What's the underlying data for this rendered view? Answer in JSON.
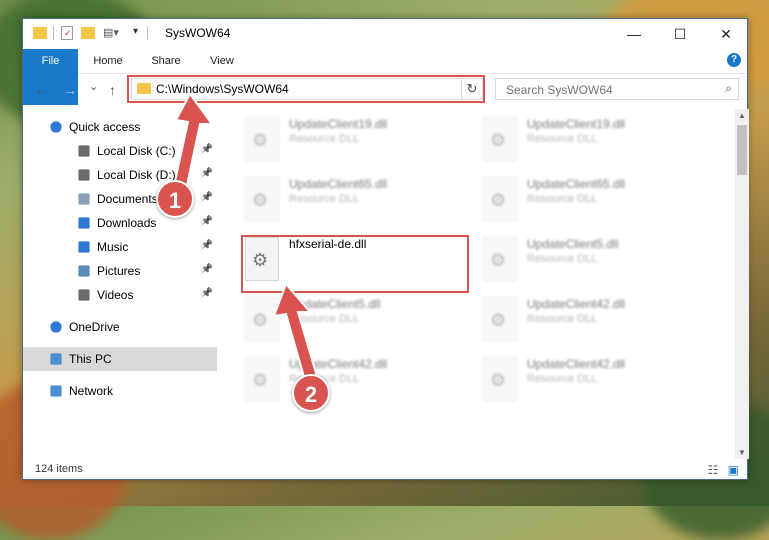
{
  "window": {
    "title": "SysWOW64",
    "controls": {
      "minimize": "—",
      "maximize": "☐",
      "close": "✕"
    }
  },
  "ribbon": {
    "tabs": [
      "File",
      "Home",
      "Share",
      "View"
    ],
    "help": "?"
  },
  "navigation": {
    "back": "←",
    "forward": "→",
    "recent": "⌄",
    "up": "↑"
  },
  "address": {
    "path": "C:\\Windows\\SysWOW64",
    "dropdown": "⌄",
    "refresh": "↻"
  },
  "search": {
    "placeholder": "Search SysWOW64",
    "icon": "⌕"
  },
  "sidebar": {
    "items": [
      {
        "label": "Quick access",
        "icon": "star-icon"
      },
      {
        "label": "Local Disk (C:)",
        "icon": "drive-icon",
        "pinned": true
      },
      {
        "label": "Local Disk (D:)",
        "icon": "drive-icon",
        "pinned": true
      },
      {
        "label": "Documents",
        "icon": "documents-icon",
        "pinned": true
      },
      {
        "label": "Downloads",
        "icon": "download-icon",
        "pinned": true
      },
      {
        "label": "Music",
        "icon": "music-icon",
        "pinned": true
      },
      {
        "label": "Pictures",
        "icon": "pictures-icon",
        "pinned": true
      },
      {
        "label": "Videos",
        "icon": "videos-icon",
        "pinned": true
      },
      {
        "label": "OneDrive",
        "icon": "cloud-icon"
      },
      {
        "label": "This PC",
        "icon": "computer-icon",
        "selected": true
      },
      {
        "label": "Network",
        "icon": "network-icon"
      }
    ],
    "pin_glyph": "📌"
  },
  "files": [
    {
      "name": "UpdateClient19.dll",
      "type": "Resource DLL",
      "blurred": true
    },
    {
      "name": "UpdateClient19.dll",
      "type": "Resource DLL",
      "blurred": true
    },
    {
      "name": "UpdateClient65.dll",
      "type": "Resource DLL",
      "blurred": true
    },
    {
      "name": "UpdateClient65.dll",
      "type": "Resource DLL",
      "blurred": true
    },
    {
      "name": "hfxserial-de.dll",
      "type": "",
      "blurred": false
    },
    {
      "name": "UpdateClient5.dll",
      "type": "Resource DLL",
      "blurred": true
    },
    {
      "name": "UpdateClient5.dll",
      "type": "Resource DLL",
      "blurred": true
    },
    {
      "name": "UpdateClient42.dll",
      "type": "Resource DLL",
      "blurred": true
    },
    {
      "name": "UpdateClient42.dll",
      "type": "Resource DLL",
      "blurred": true
    },
    {
      "name": "UpdateClient42.dll",
      "type": "Resource DLL",
      "blurred": true
    }
  ],
  "status": {
    "count": "124 items"
  },
  "callouts": {
    "one": "1",
    "two": "2"
  },
  "colors": {
    "accent": "#1979ca",
    "highlight": "#d9534f",
    "folder": "#f5c64a",
    "selected": "#d9d9d9"
  }
}
